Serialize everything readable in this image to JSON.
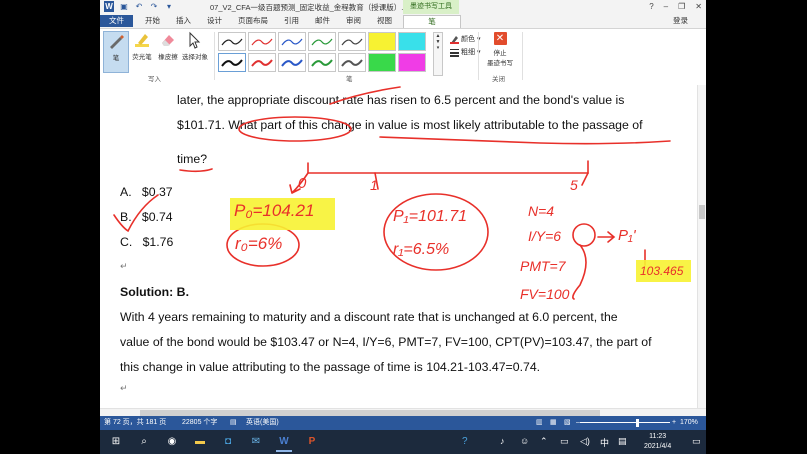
{
  "window": {
    "doc_title": "07_V2_CFA一级百题预测_固定收益_金程教育（授课版）...",
    "context_group": "墨迹书写工具",
    "controls": [
      "?",
      "–",
      "❐",
      "✕"
    ]
  },
  "tabs": [
    "文件",
    "开始",
    "插入",
    "设计",
    "页面布局",
    "引用",
    "邮件",
    "审阅",
    "视图",
    "笔"
  ],
  "login_label": "登录",
  "ribbon": {
    "tools": [
      "笔",
      "荧光笔",
      "橡皮擦",
      "选择对象"
    ],
    "group_write": "写入",
    "group_pen": "笔",
    "group_close": "关闭",
    "color_label": "颜色 ▾",
    "thickness_label": "粗细 ▾",
    "stop_label_1": "停止",
    "stop_label_2": "墨迹书写"
  },
  "document": {
    "line1": "later, the appropriate discount rate has risen to 6.5 percent and the bond's value is",
    "line2": "$101.71. What part of this change in value is most likely attributable to the passage of",
    "line3": "time?",
    "options": [
      {
        "letter": "A.",
        "value": "$0.37"
      },
      {
        "letter": "B.",
        "value": "$0.74"
      },
      {
        "letter": "C.",
        "value": "$1.76"
      }
    ],
    "solution_title": "Solution: B.",
    "sol_line1": "With 4 years remaining to maturity and a discount rate that is unchanged at 6.0 percent, the",
    "sol_line2": "value of the bond would be $103.47 or N=4, I/Y=6, PMT=7, FV=100, CPT(PV)=103.47, the part of",
    "sol_line3": "this change in value attributing to the passage of time is 104.21-103.47=0.74.",
    "para_mark": "↵"
  },
  "annotations": {
    "t0": "0",
    "t1": "1",
    "t5": "5",
    "p0": "P₀=104.21",
    "r0": "r₀=6%",
    "p1": "P₁=101.71",
    "r1": "r₁=6.5%",
    "n": "N=4",
    "iy": "I/Y=6",
    "pmt": "PMT=7",
    "fv": "FV=100",
    "p1prime": "P₁'",
    "result": "103.465"
  },
  "colors": {
    "ink": "#e8302a",
    "highlight": "#f7f232",
    "word_blue": "#2b579a"
  },
  "status": {
    "page": "第 72 页，共 181 页",
    "words": "22805 个字",
    "lang": "英语(美国)",
    "zoom": "170%"
  },
  "taskbar": {
    "time": "11:23",
    "date": "2021/4/4",
    "ime": "中"
  }
}
